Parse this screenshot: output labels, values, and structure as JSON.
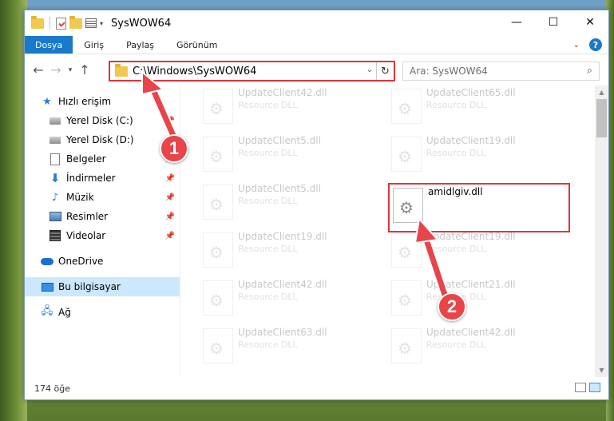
{
  "window": {
    "title": "SysWOW64"
  },
  "ribbon": {
    "tabs": [
      "Dosya",
      "Giriş",
      "Paylaş",
      "Görünüm"
    ]
  },
  "address": {
    "path": "C:\\Windows\\SysWOW64"
  },
  "search": {
    "placeholder": "Ara: SysWOW64"
  },
  "sidebar": {
    "items": [
      {
        "label": "Hızlı erişim"
      },
      {
        "label": "Yerel Disk (C:)"
      },
      {
        "label": "Yerel Disk (D:)"
      },
      {
        "label": "Belgeler"
      },
      {
        "label": "İndirmeler"
      },
      {
        "label": "Müzik"
      },
      {
        "label": "Resimler"
      },
      {
        "label": "Videolar"
      },
      {
        "label": "OneDrive"
      },
      {
        "label": "Bu bilgisayar"
      },
      {
        "label": "Ağ"
      }
    ]
  },
  "files": [
    {
      "name": "UpdateClient42.dll",
      "desc": "Resource DLL"
    },
    {
      "name": "UpdateClient65.dll",
      "desc": "Resource DLL"
    },
    {
      "name": "UpdateClient5.dll",
      "desc": "Resource DLL"
    },
    {
      "name": "UpdateClient19.dll",
      "desc": "Resource DLL"
    },
    {
      "name": "UpdateClient5.dll",
      "desc": "Resource DLL"
    },
    {
      "name": "amidlgiv.dll",
      "desc": ""
    },
    {
      "name": "UpdateClient19.dll",
      "desc": "Resource DLL"
    },
    {
      "name": "UpdateClient19.dll",
      "desc": "Resource DLL"
    },
    {
      "name": "UpdateClient42.dll",
      "desc": "Resource DLL"
    },
    {
      "name": "UpdateClient21.dll",
      "desc": "Resource DLL"
    },
    {
      "name": "UpdateClient63.dll",
      "desc": "Resource DLL"
    },
    {
      "name": "UpdateClient42.dll",
      "desc": "Resource DLL"
    }
  ],
  "status": {
    "count": "174 öğe"
  },
  "callouts": [
    "1",
    "2"
  ],
  "colors": {
    "accent": "#1979ca",
    "highlight": "#e0353a",
    "selection": "#cce8ff"
  }
}
